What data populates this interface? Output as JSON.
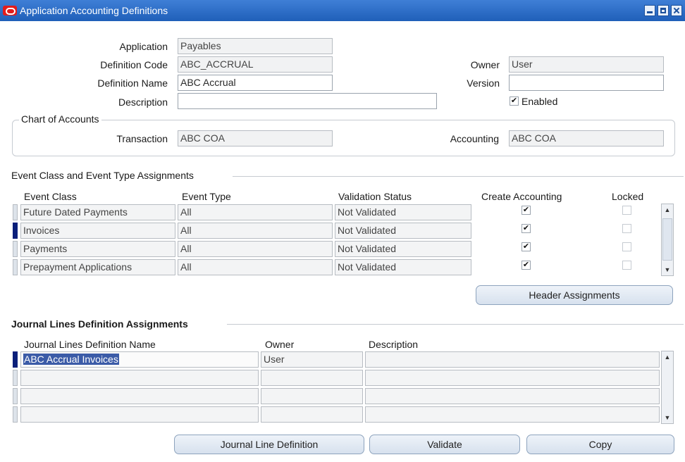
{
  "window": {
    "title": "Application Accounting Definitions"
  },
  "form": {
    "application_label": "Application",
    "application_value": "Payables",
    "definition_code_label": "Definition Code",
    "definition_code_value": "ABC_ACCRUAL",
    "definition_name_label": "Definition Name",
    "definition_name_value": "ABC Accrual",
    "description_label": "Description",
    "description_value": "",
    "owner_label": "Owner",
    "owner_value": "User",
    "version_label": "Version",
    "version_value": "",
    "enabled_label": "Enabled",
    "enabled_checked": true
  },
  "chart_of_accounts": {
    "title": "Chart of Accounts",
    "transaction_label": "Transaction",
    "transaction_value": "ABC COA",
    "accounting_label": "Accounting",
    "accounting_value": "ABC COA"
  },
  "event_assignments": {
    "title": "Event Class and Event Type Assignments",
    "columns": [
      "Event Class",
      "Event Type",
      "Validation Status",
      "Create Accounting",
      "Locked"
    ],
    "rows": [
      {
        "event_class": "Future Dated Payments",
        "event_type": "All",
        "status": "Not Validated",
        "create_accounting": true,
        "locked": false
      },
      {
        "event_class": "Invoices",
        "event_type": "All",
        "status": "Not Validated",
        "create_accounting": true,
        "locked": false
      },
      {
        "event_class": "Payments",
        "event_type": "All",
        "status": "Not Validated",
        "create_accounting": true,
        "locked": false
      },
      {
        "event_class": "Prepayment Applications",
        "event_type": "All",
        "status": "Not Validated",
        "create_accounting": true,
        "locked": false
      }
    ],
    "header_assignments_button": "Header Assignments"
  },
  "journal_lines": {
    "title": "Journal Lines Definition Assignments",
    "columns": [
      "Journal Lines Definition Name",
      "Owner",
      "Description"
    ],
    "rows": [
      {
        "name": "ABC Accrual Invoices",
        "owner": "User",
        "description": ""
      },
      {
        "name": "",
        "owner": "",
        "description": ""
      },
      {
        "name": "",
        "owner": "",
        "description": ""
      },
      {
        "name": "",
        "owner": "",
        "description": ""
      }
    ]
  },
  "buttons": {
    "journal_line_definition": "Journal Line Definition",
    "validate": "Validate",
    "copy": "Copy"
  },
  "icons": {
    "app_icon": "oracle-logo-icon",
    "check_mark": "✔"
  }
}
